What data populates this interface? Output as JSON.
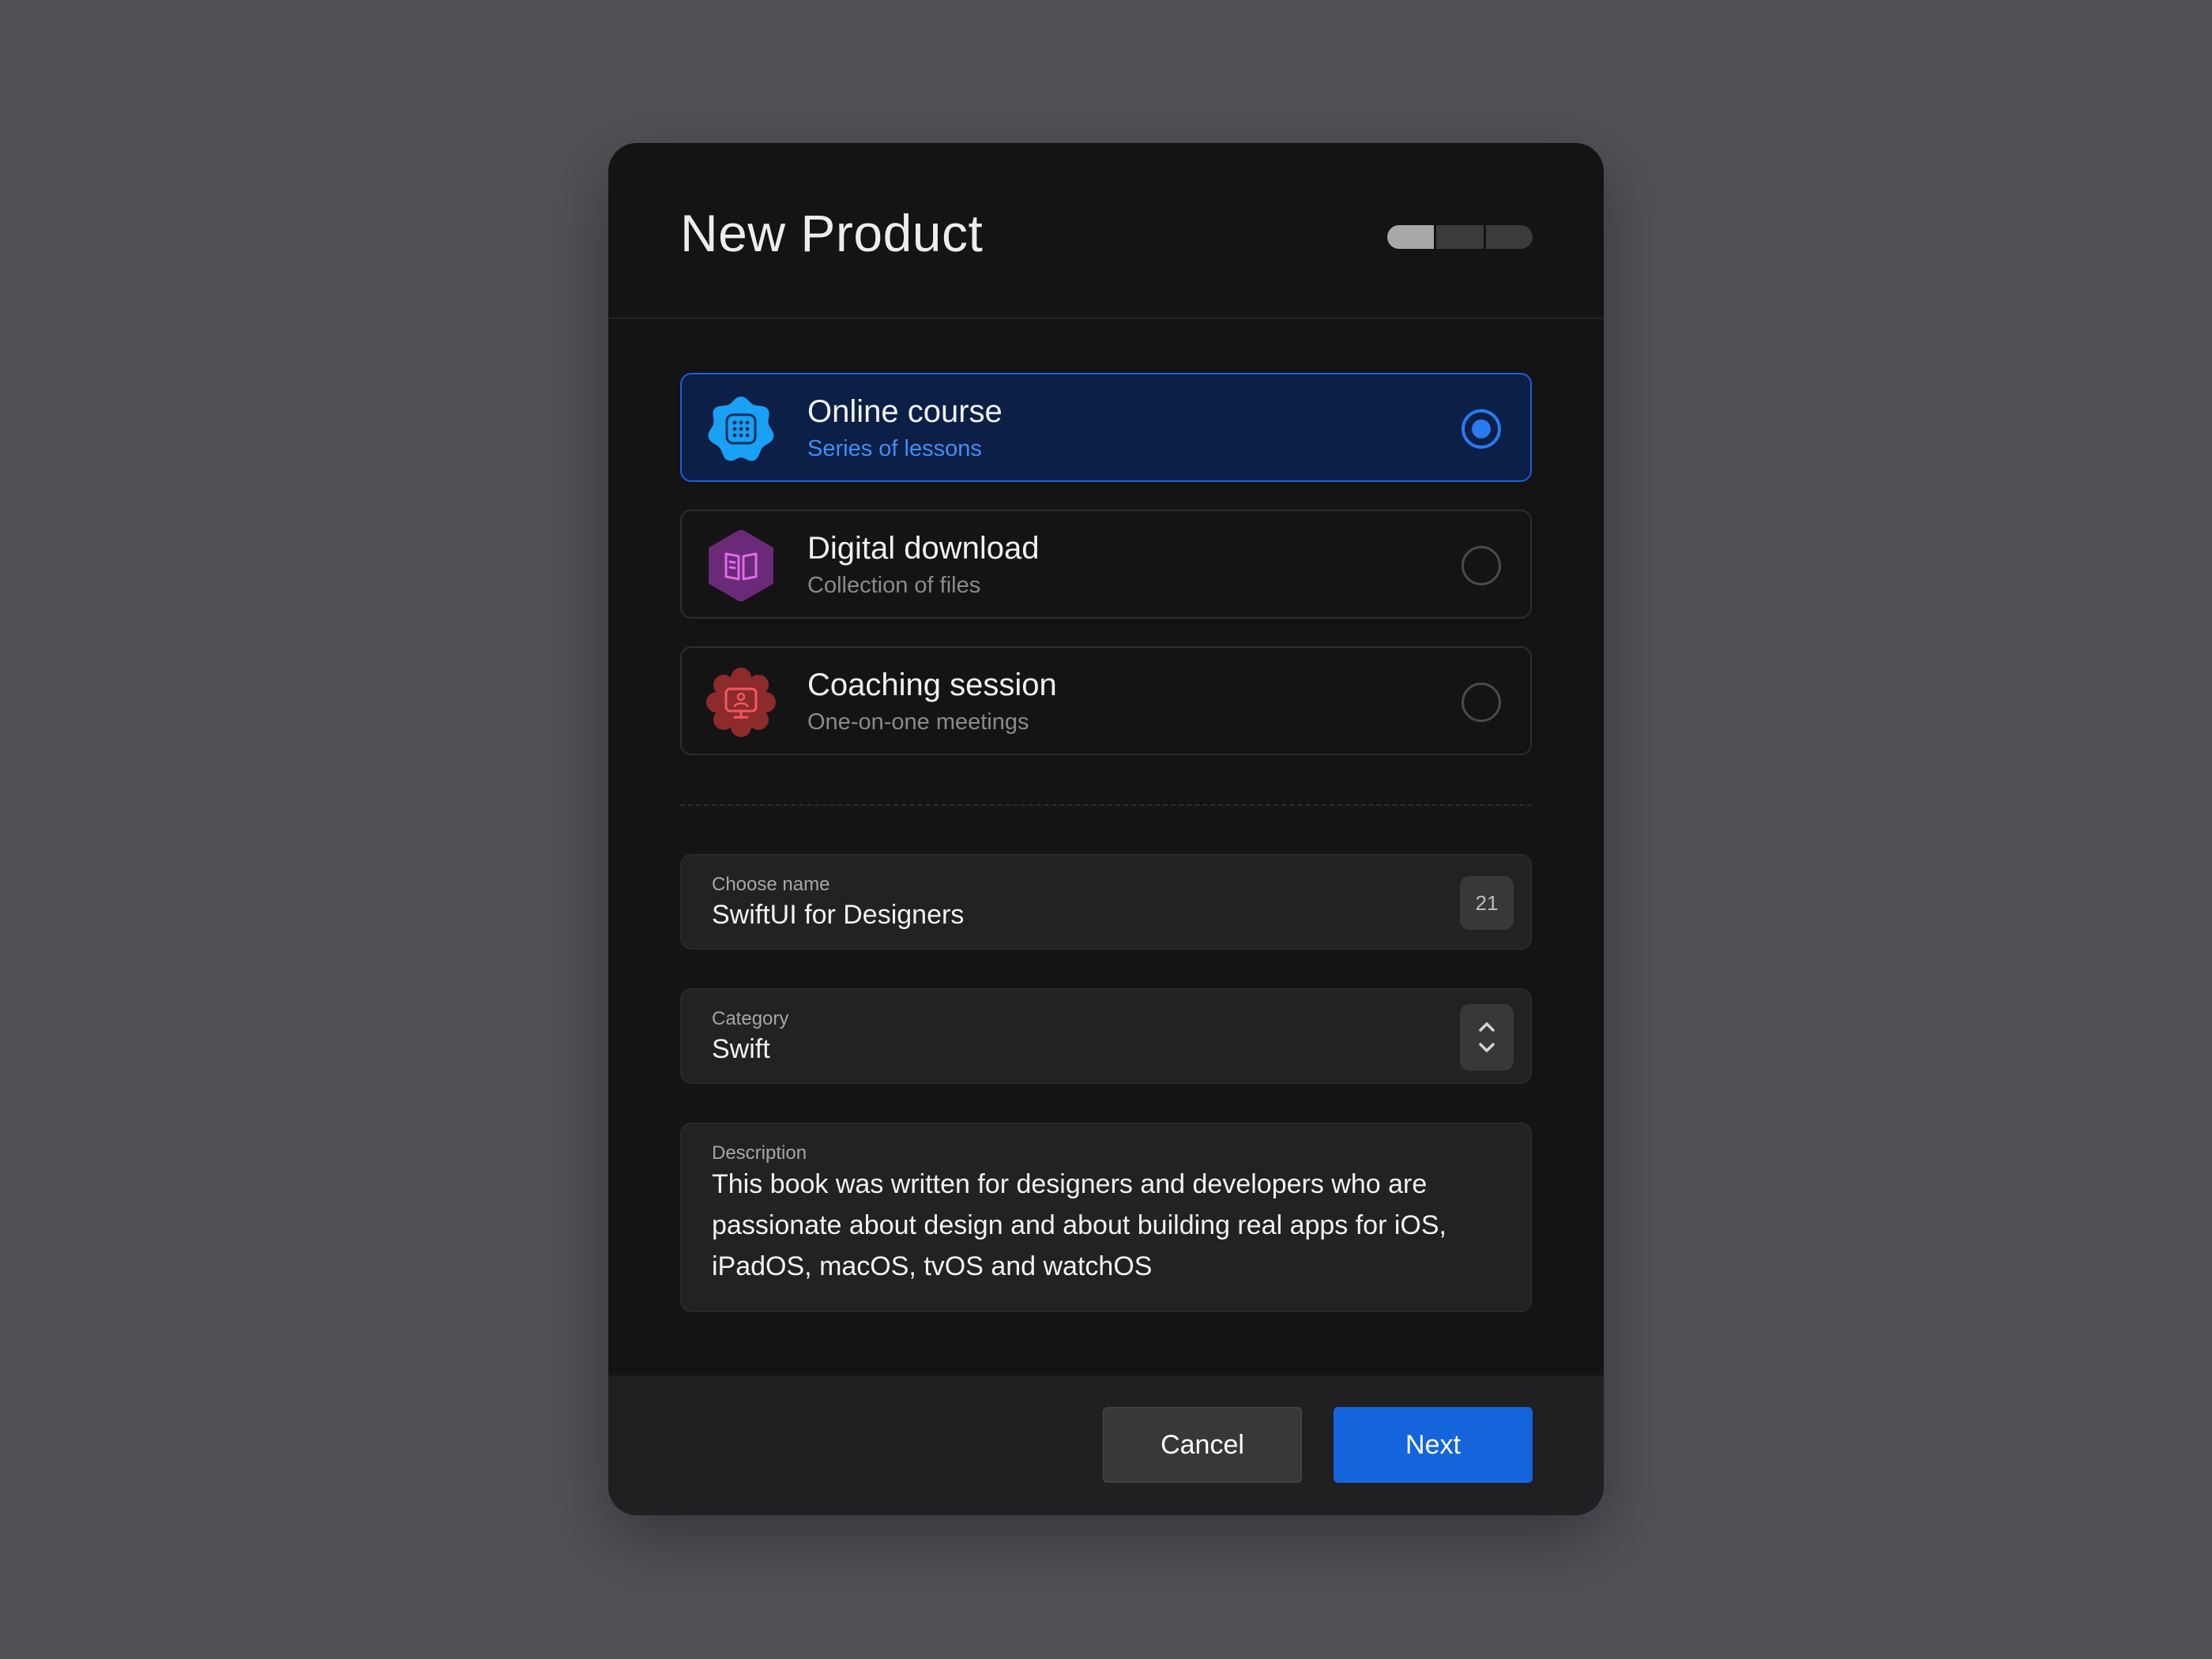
{
  "dialog": {
    "title": "New Product",
    "steps": {
      "total": 3,
      "current": 1
    }
  },
  "options": [
    {
      "title": "Online course",
      "subtitle": "Series of lessons",
      "icon": "grid-icon",
      "color": "#1aa0f5",
      "selected": true
    },
    {
      "title": "Digital download",
      "subtitle": "Collection of files",
      "icon": "book-icon",
      "color": "#6b2a78",
      "selected": false
    },
    {
      "title": "Coaching session",
      "subtitle": "One-on-one meetings",
      "icon": "monitor-user-icon",
      "color": "#8c2a2c",
      "selected": false
    }
  ],
  "form": {
    "name": {
      "label": "Choose name",
      "value": "SwiftUI for Designers",
      "count": "21"
    },
    "category": {
      "label": "Category",
      "value": "Swift"
    },
    "description": {
      "label": "Description",
      "value": "This book was written for designers and developers who are passionate about design and about building real apps for iOS, iPadOS, macOS, tvOS and watchOS"
    }
  },
  "footer": {
    "cancel_label": "Cancel",
    "next_label": "Next"
  },
  "colors": {
    "accent": "#1464dc",
    "selected_bg": "#0b1f47",
    "background": "#515258",
    "surface": "#141415"
  }
}
